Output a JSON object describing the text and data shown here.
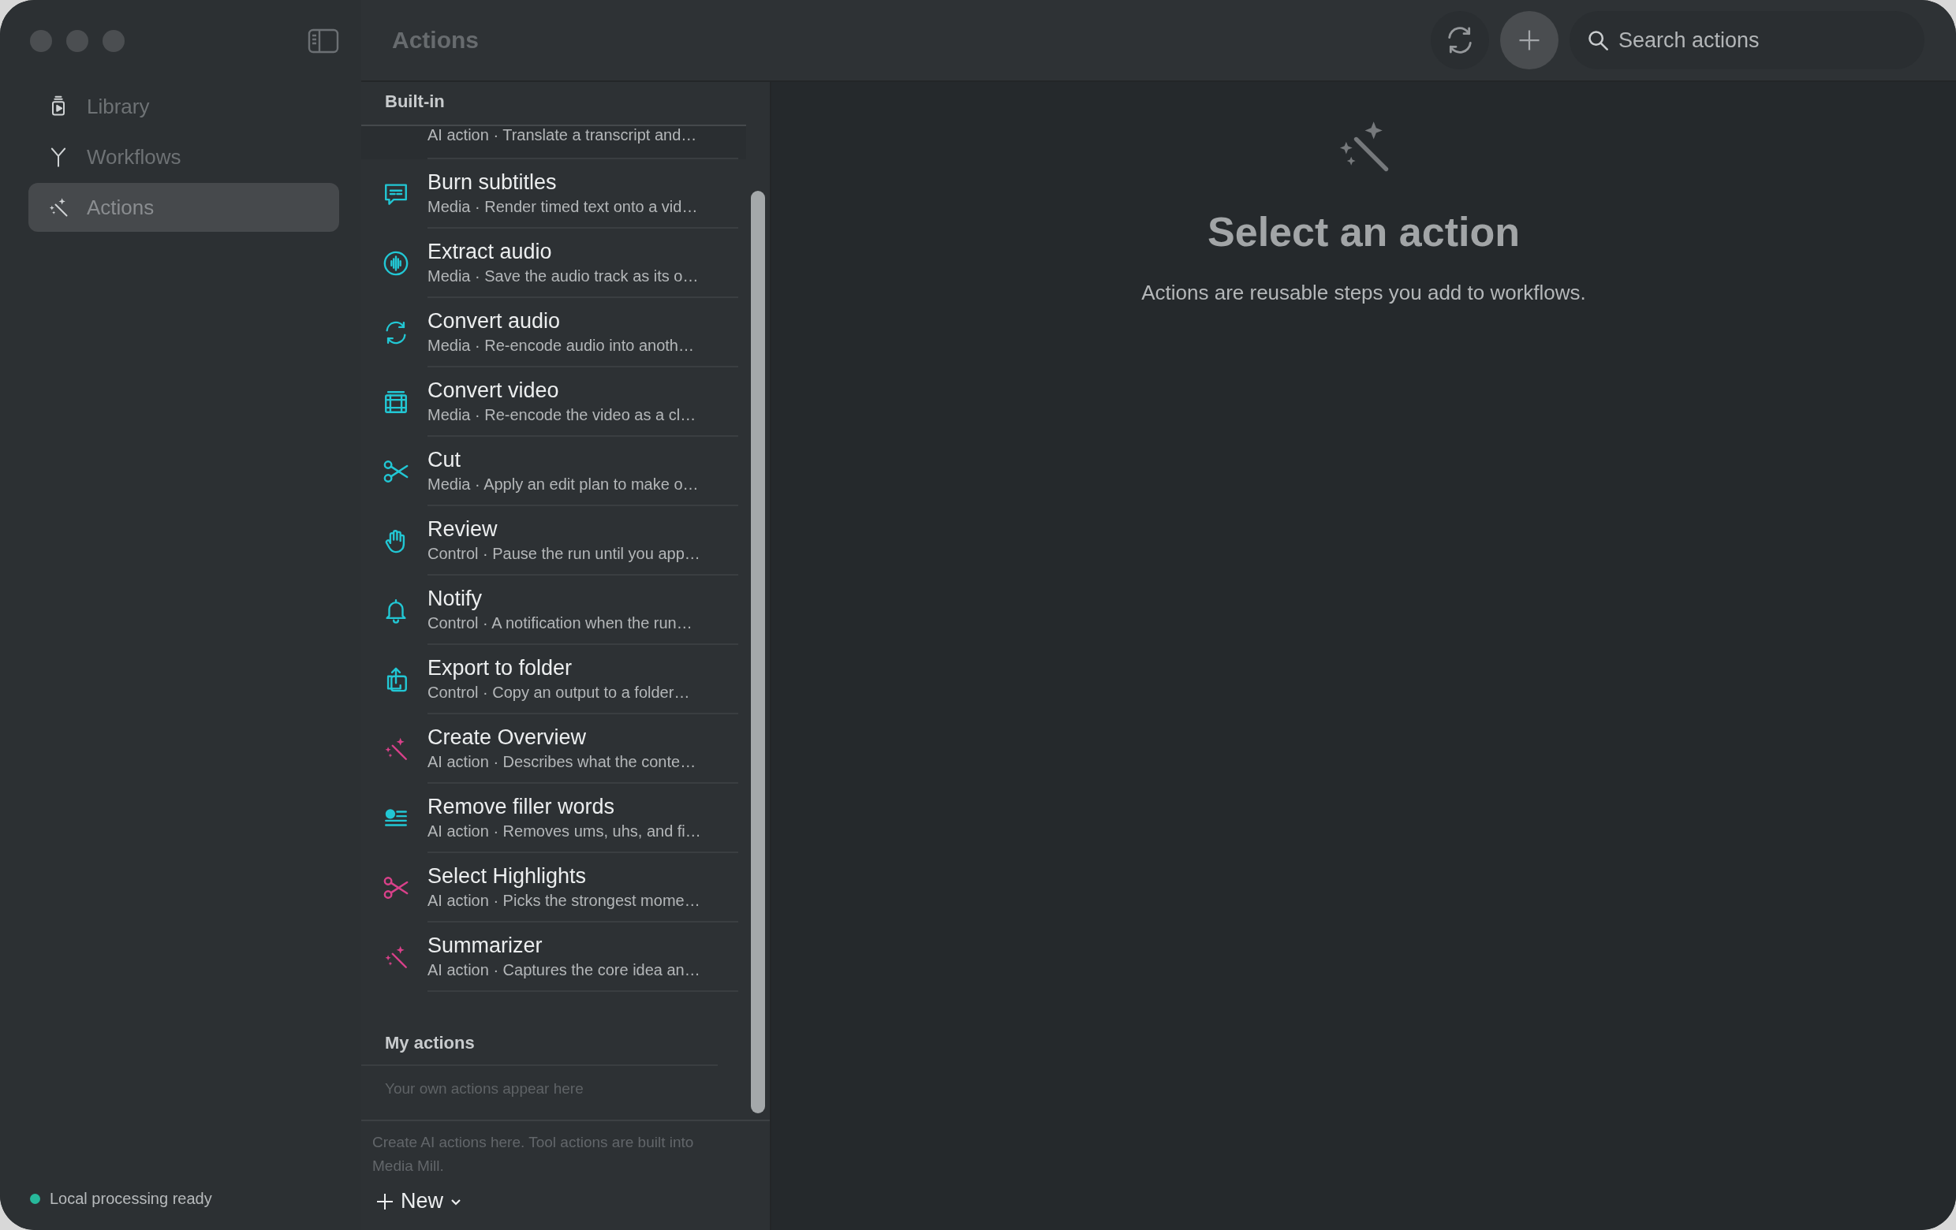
{
  "window": {
    "title": "Actions"
  },
  "sidebar": {
    "items": [
      {
        "label": "Library",
        "kind": "library",
        "selected": false
      },
      {
        "label": "Workflows",
        "kind": "fork",
        "selected": false
      },
      {
        "label": "Actions",
        "kind": "wand",
        "selected": true
      }
    ],
    "status": "Local processing ready"
  },
  "toolbar": {
    "search": {
      "placeholder": "Search actions"
    }
  },
  "actions": {
    "sections": [
      {
        "heading": "Built-in",
        "items": [
          {
            "subtitle": "AI action · Translate a transcript and…"
          },
          {
            "title": "Burn subtitles",
            "subtitle": "Media · Render timed text onto a vid…",
            "kind": "subtitles",
            "color": "#22c7d4"
          },
          {
            "title": "Extract audio",
            "subtitle": "Media · Save the audio track as its o…",
            "kind": "wave",
            "color": "#22c7d4"
          },
          {
            "title": "Convert audio",
            "subtitle": "Media · Re-encode audio into anoth…",
            "kind": "cycle",
            "color": "#22c7d4"
          },
          {
            "title": "Convert video",
            "subtitle": "Media · Re-encode the video as a cl…",
            "kind": "film",
            "color": "#22c7d4"
          },
          {
            "title": "Cut",
            "subtitle": "Media · Apply an edit plan to make o…",
            "kind": "scissors",
            "color": "#22c7d4"
          },
          {
            "title": "Review",
            "subtitle": "Control · Pause the run until you app…",
            "kind": "hand",
            "color": "#22c7d4"
          },
          {
            "title": "Notify",
            "subtitle": "Control · A notification when the run…",
            "kind": "bell",
            "color": "#22c7d4"
          },
          {
            "title": "Export to folder",
            "subtitle": "Control · Copy an output to a folder…",
            "kind": "export",
            "color": "#22c7d4"
          },
          {
            "title": "Create Overview",
            "subtitle": "AI action · Describes what the conte…",
            "kind": "wand",
            "color": "#d9418a"
          },
          {
            "title": "Remove filler words",
            "subtitle": "AI action · Removes ums, uhs, and fi…",
            "kind": "lines",
            "color": "#22c7d4"
          },
          {
            "title": "Select Highlights",
            "subtitle": "AI action · Picks the strongest mome…",
            "kind": "scissors",
            "color": "#d9418a"
          },
          {
            "title": "Summarizer",
            "subtitle": "AI action · Captures the core idea an…",
            "kind": "wand",
            "color": "#d9418a"
          }
        ]
      },
      {
        "heading": "My actions",
        "empty_text": "Your own actions appear here"
      }
    ]
  },
  "footer": {
    "hint": "Create AI actions here. Tool actions are built into Media Mill.",
    "new_button": "New"
  },
  "detail": {
    "title": "Select an action",
    "description": "Actions are reusable steps you add to workflows."
  }
}
